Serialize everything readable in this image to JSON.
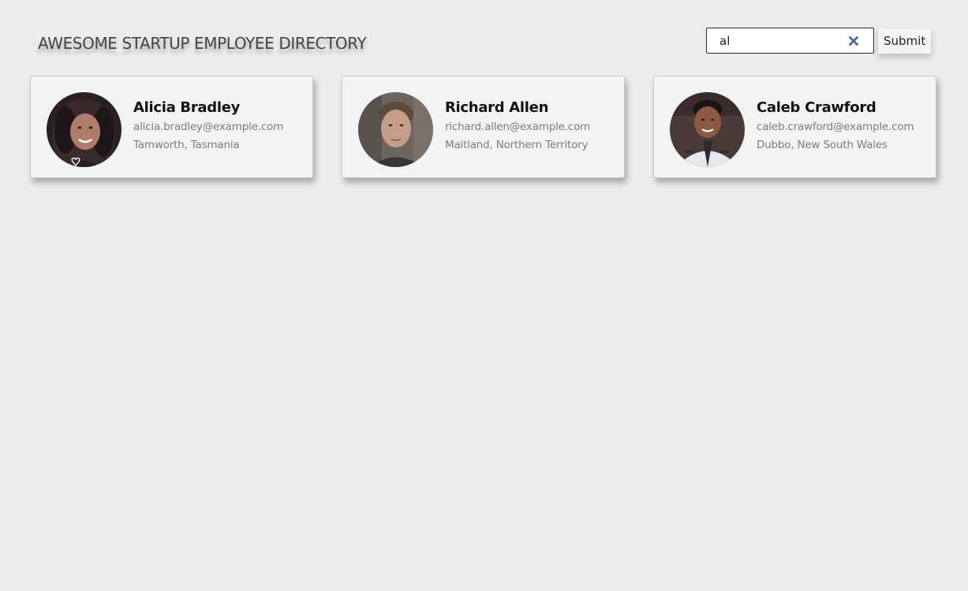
{
  "header": {
    "title": "AWESOME STARTUP EMPLOYEE DIRECTORY"
  },
  "search": {
    "value": "al",
    "submit_label": "Submit",
    "clear_icon": "close-icon"
  },
  "employees": [
    {
      "name": "Alicia Bradley",
      "email": "alicia.bradley@example.com",
      "location": "Tamworth, Tasmania"
    },
    {
      "name": "Richard Allen",
      "email": "richard.allen@example.com",
      "location": "Maitland, Northern Territory"
    },
    {
      "name": "Caleb Crawford",
      "email": "caleb.crawford@example.com",
      "location": "Dubbo, New South Wales"
    }
  ],
  "colors": {
    "background": "#ececec",
    "card_background": "#f3f3f3",
    "title_text": "#444444",
    "secondary_text": "#7c7c7c",
    "clear_icon": "#4a6a9a"
  }
}
